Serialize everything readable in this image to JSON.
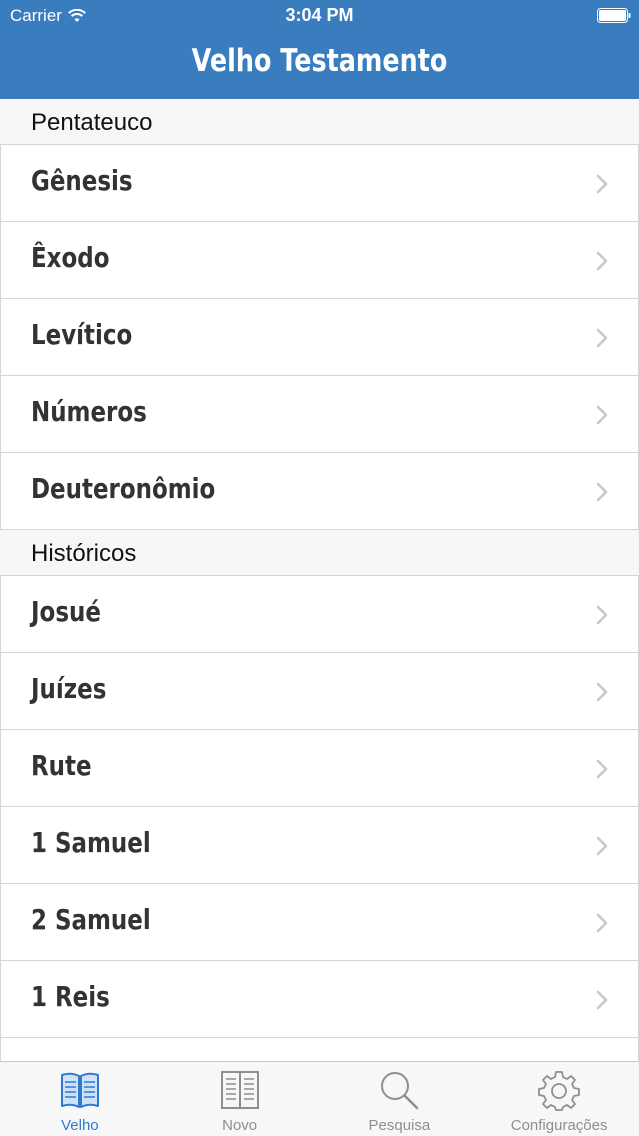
{
  "status_bar": {
    "carrier": "Carrier",
    "time": "3:04 PM"
  },
  "nav": {
    "title": "Velho Testamento"
  },
  "sections": [
    {
      "header": "Pentateuco",
      "items": [
        "Gênesis",
        "Êxodo",
        "Levítico",
        "Números",
        "Deuteronômio"
      ]
    },
    {
      "header": "Históricos",
      "items": [
        "Josué",
        "Juízes",
        "Rute",
        "1 Samuel",
        "2 Samuel",
        "1 Reis"
      ]
    }
  ],
  "tabs": [
    {
      "label": "Velho",
      "icon": "open-book-icon",
      "active": true
    },
    {
      "label": "Novo",
      "icon": "book-icon",
      "active": false
    },
    {
      "label": "Pesquisa",
      "icon": "search-icon",
      "active": false
    },
    {
      "label": "Configurações",
      "icon": "gear-icon",
      "active": false
    }
  ],
  "colors": {
    "nav_background": "#3a7dbf",
    "tab_active": "#2f7ad1",
    "tab_inactive": "#8e8e93",
    "chevron": "#c7c7cc"
  }
}
